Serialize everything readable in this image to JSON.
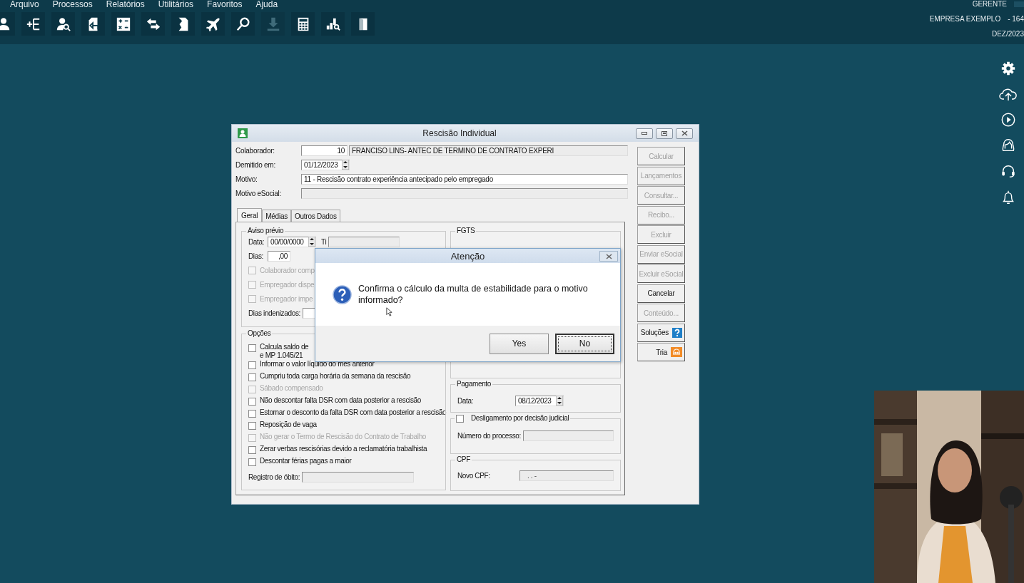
{
  "menu": [
    "Arquivo",
    "Processos",
    "Relatórios",
    "Utilitários",
    "Favoritos",
    "Ajuda"
  ],
  "toolbar": [
    {
      "kind": "user",
      "disabled": false
    },
    {
      "kind": "add-list",
      "disabled": false
    },
    {
      "kind": "user-search",
      "disabled": false
    },
    {
      "kind": "document",
      "disabled": false
    },
    {
      "kind": "math",
      "disabled": false
    },
    {
      "kind": "arrows",
      "disabled": false
    },
    {
      "kind": "folded-page",
      "disabled": false
    },
    {
      "kind": "airplane",
      "disabled": false
    },
    {
      "kind": "search",
      "disabled": false
    },
    {
      "kind": "download",
      "disabled": true
    },
    {
      "kind": "calculator",
      "disabled": false
    },
    {
      "kind": "chart-search",
      "disabled": false
    },
    {
      "kind": "door",
      "disabled": false
    }
  ],
  "session": {
    "user": "GERENTE",
    "company": "EMPRESA EXEMPLO",
    "company_code": "- 164",
    "period": "DEZ/2023"
  },
  "window": {
    "title": "Rescisão Individual",
    "employee": {
      "label": "Colaborador:",
      "code": "10",
      "name": "FRANCISO LINS- ANTEC DE TERMINO DE CONTRATO EXPERI"
    },
    "dismissal_date": {
      "label": "Demitido em:",
      "value": "01/12/2023"
    },
    "reason": {
      "label": "Motivo:",
      "value": "11 - Rescisão contrato experiência antecipado pelo empregado"
    },
    "esocial_reason": {
      "label": "Motivo eSocial:"
    },
    "tabs": [
      {
        "label": "Geral",
        "selected": true
      },
      {
        "label": "Médias",
        "selected": false
      },
      {
        "label": "Outros Dados",
        "selected": false
      }
    ],
    "notice": {
      "title": "Aviso prévio",
      "date_label": "Data:",
      "date": "00/00/0000",
      "type_label": "Ti",
      "days_label": "Dias:",
      "days": ",00",
      "options": [
        {
          "label": "Colaborador comp",
          "checked": false,
          "disabled": true
        },
        {
          "label": "Empregador dispe",
          "checked": false,
          "disabled": true
        },
        {
          "label": "Empregador impe",
          "checked": false,
          "disabled": true
        }
      ],
      "indemnified_label": "Dias indenizados:"
    },
    "options": {
      "title": "Opções",
      "items": [
        {
          "lines": [
            "Calcula saldo de",
            "e MP 1.045/21"
          ],
          "checked": false,
          "disabled": false
        },
        {
          "lines": [
            "Informar o valor líquido do mês anterior"
          ],
          "checked": false,
          "disabled": false
        },
        {
          "lines": [
            "Cumpriu toda carga horária da semana da rescisão"
          ],
          "checked": false,
          "disabled": false
        },
        {
          "lines": [
            "Sábado compensado"
          ],
          "checked": false,
          "disabled": true
        },
        {
          "lines": [
            "Não descontar falta DSR com data posterior a rescisão"
          ],
          "checked": false,
          "disabled": false
        },
        {
          "lines": [
            "Estornar o desconto da falta DSR com data posterior a rescisão"
          ],
          "checked": false,
          "disabled": false
        },
        {
          "lines": [
            "Reposição de vaga"
          ],
          "checked": false,
          "disabled": false
        },
        {
          "lines": [
            "Não gerar o Termo de Rescisão do Contrato de Trabalho"
          ],
          "checked": false,
          "disabled": true
        },
        {
          "lines": [
            "Zerar verbas rescisórias devido a reclamatória trabalhista"
          ],
          "checked": false,
          "disabled": false
        },
        {
          "lines": [
            "Descontar férias pagas a maior"
          ],
          "checked": false,
          "disabled": false
        }
      ],
      "death_record_label": "Registro de óbito:"
    },
    "fgts": {
      "title": "FGTS"
    },
    "payment": {
      "title": "Pagamento",
      "date_label": "Data:",
      "date": "08/12/2023"
    },
    "judicial": {
      "label": "Desligamento por decisão judicial",
      "checked": false,
      "process_label": "Número do processo:"
    },
    "cpf": {
      "title": "CPF",
      "label": "Novo CPF:",
      "value": ". . -"
    },
    "buttons": [
      {
        "label": "Calcular",
        "kind": "plain",
        "disabled": true
      },
      {
        "label": "Lançamentos",
        "kind": "plain",
        "disabled": true
      },
      {
        "label": "Consultar...",
        "kind": "plain",
        "disabled": true
      },
      {
        "label": "Recibo...",
        "kind": "plain",
        "disabled": true
      },
      {
        "label": "Excluir",
        "kind": "plain",
        "disabled": true
      },
      {
        "label": "Enviar eSocial",
        "kind": "plain",
        "disabled": true
      },
      {
        "label": "Excluir eSocial",
        "kind": "plain",
        "disabled": true
      },
      {
        "label": "Cancelar",
        "kind": "plain",
        "disabled": false
      },
      {
        "label": "Conteúdo...",
        "kind": "plain",
        "disabled": true
      },
      {
        "label": "Soluções",
        "kind": "help",
        "disabled": false
      },
      {
        "label": "Tria",
        "kind": "tria",
        "disabled": false
      }
    ]
  },
  "dialog": {
    "title": "Atenção",
    "message": "Confirma o cálculo da multa de estabilidade para o motivo informado?",
    "buttons": [
      {
        "label": "Yes",
        "focused": false
      },
      {
        "label": "No",
        "focused": true
      }
    ]
  }
}
